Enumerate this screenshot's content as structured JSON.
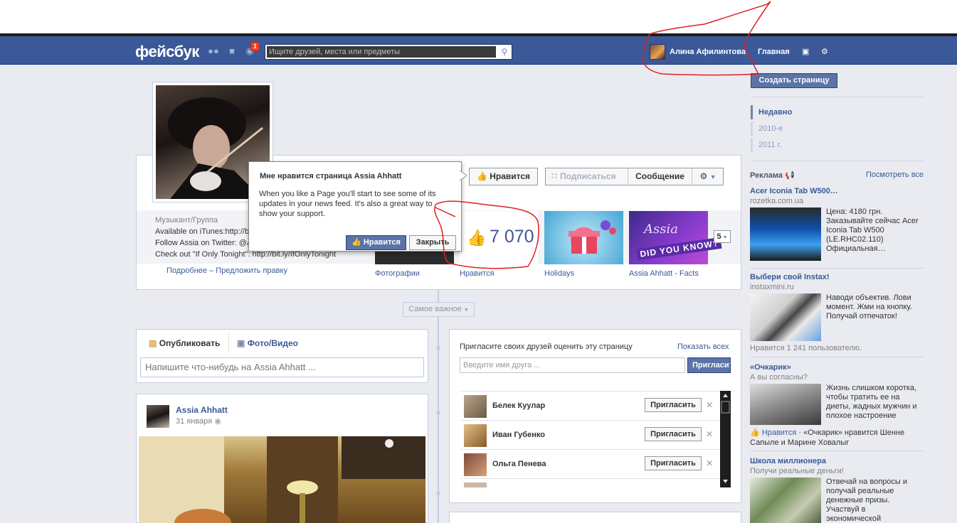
{
  "header": {
    "logo": "фейсбук",
    "notifications_count": "1",
    "search_placeholder": "Ищите друзей, места или предметы",
    "user_name": "Алина Афилинтова",
    "home": "Главная"
  },
  "sidebar": {
    "create_page": "Создать страницу",
    "years": [
      "Недавно",
      "2010-е",
      "2011 г."
    ],
    "ads_title": "Реклама",
    "ads_all": "Посмотреть все",
    "ads": [
      {
        "title": "Acer Iconia Tab W500…",
        "source": "rozetka.com.ua",
        "text": "Цена: 4180 грн. Заказывайте сейчас Acer Iconia Tab W500 (LE.RHC02.110) Официальная…"
      },
      {
        "title": "Выбери свой Instax!",
        "source": "instaxmini.ru",
        "text": "Наводи объектив. Лови момент. Жми на кнопку. Получай отпечаток!",
        "likes": "Нравится 1 241 пользователю."
      },
      {
        "title": "«Очкарик»",
        "source": "А вы согласны?",
        "text": "Жизнь слишком коротка, чтобы тратить ее на диеты, жадных мужчин и плохое настроение",
        "social_like": "Нравится",
        "social_text": "· «Очкарик» нравится Шенне Сапыле и Марине Ховалыг"
      },
      {
        "title": "Школа миллионера",
        "source": "Получи реальные деньги!",
        "text": "Отвечай на вопросы и получай реальные денежные призы. Участвуй в экономической"
      }
    ]
  },
  "profile": {
    "category": "Музыкант/Группа",
    "about": [
      "Available on iTunes:http://b",
      "Follow Assia on Twitter: @A",
      "Check out \"If Only Tonight\": http://bit.ly/IfOnlyTonight"
    ],
    "more": "Подробнее",
    "suggest": "– Предложить правку",
    "like_button": "Нравится",
    "subscribe_button": "Подписаться",
    "message_button": "Сообщение",
    "likes_count": "7 070",
    "tiles": [
      "Фотографии",
      "Нравится",
      "Holidays",
      "Assia Ahhatt - Facts"
    ],
    "tiles_more": "5",
    "facts_caption": "DID YOU KNOW?",
    "facts_logo": "Assia"
  },
  "popup": {
    "title": "Мне нравится страница Assia Ahhatt",
    "text": "When you like a Page you'll start to see some of its updates in your news feed. It's also a great way to show your support.",
    "like": "Нравится",
    "close": "Закрыть"
  },
  "timeline": {
    "filter": "Самое важное",
    "composer_tabs": [
      "Опубликовать",
      "Фото/Видео"
    ],
    "composer_placeholder": "Напишите что-нибудь на Assia Ahhatt ...",
    "post_author": "Assia Ahhatt",
    "post_date": "31 января",
    "invite_title": "Пригласите своих друзей оценить эту страницу",
    "invite_all": "Показать всех",
    "invite_placeholder": "Введите имя друга ...",
    "invite_button": "Пригласить",
    "friends": [
      {
        "name": "Белек Куулар",
        "button": "Пригласить"
      },
      {
        "name": "Иван Губенко",
        "button": "Пригласить"
      },
      {
        "name": "Ольга Пенева",
        "button": "Пригласить"
      }
    ]
  },
  "colors": {
    "brand": "#3b5998",
    "background": "#e9ebf0",
    "annotation": "#e02020"
  }
}
